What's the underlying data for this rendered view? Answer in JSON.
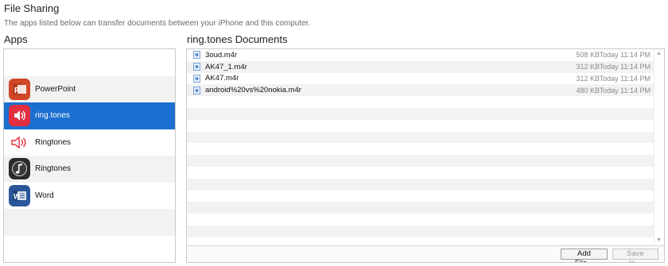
{
  "header": {
    "title": "File Sharing",
    "subtitle": "The apps listed below can transfer documents between your iPhone and this computer."
  },
  "apps": {
    "label": "Apps",
    "items": [
      {
        "name": "PowerPoint",
        "icon": "powerpoint-icon"
      },
      {
        "name": "ring.tones",
        "icon": "speaker-icon",
        "selected": true
      },
      {
        "name": "Ringtones",
        "icon": "speaker-outline-icon"
      },
      {
        "name": "Ringtones",
        "icon": "music-note-icon"
      },
      {
        "name": "Word",
        "icon": "word-icon"
      }
    ]
  },
  "documents": {
    "label": "ring.tones Documents",
    "files": [
      {
        "name": "3oud.m4r",
        "size": "508 KB",
        "date": "Today 11:14 PM"
      },
      {
        "name": "AK47_1.m4r",
        "size": "312 KB",
        "date": "Today 11:14 PM"
      },
      {
        "name": "AK47.m4r",
        "size": "312 KB",
        "date": "Today 11:14 PM"
      },
      {
        "name": "android%20vs%20nokia.m4r",
        "size": "480 KB",
        "date": "Today 11:14 PM"
      }
    ]
  },
  "buttons": {
    "add_file": "Add File...",
    "save_to": "Save to..."
  },
  "colors": {
    "selection": "#1b6fd0",
    "powerpoint": "#d24726",
    "ringtones_red": "#e0303f",
    "word": "#2b579a"
  }
}
